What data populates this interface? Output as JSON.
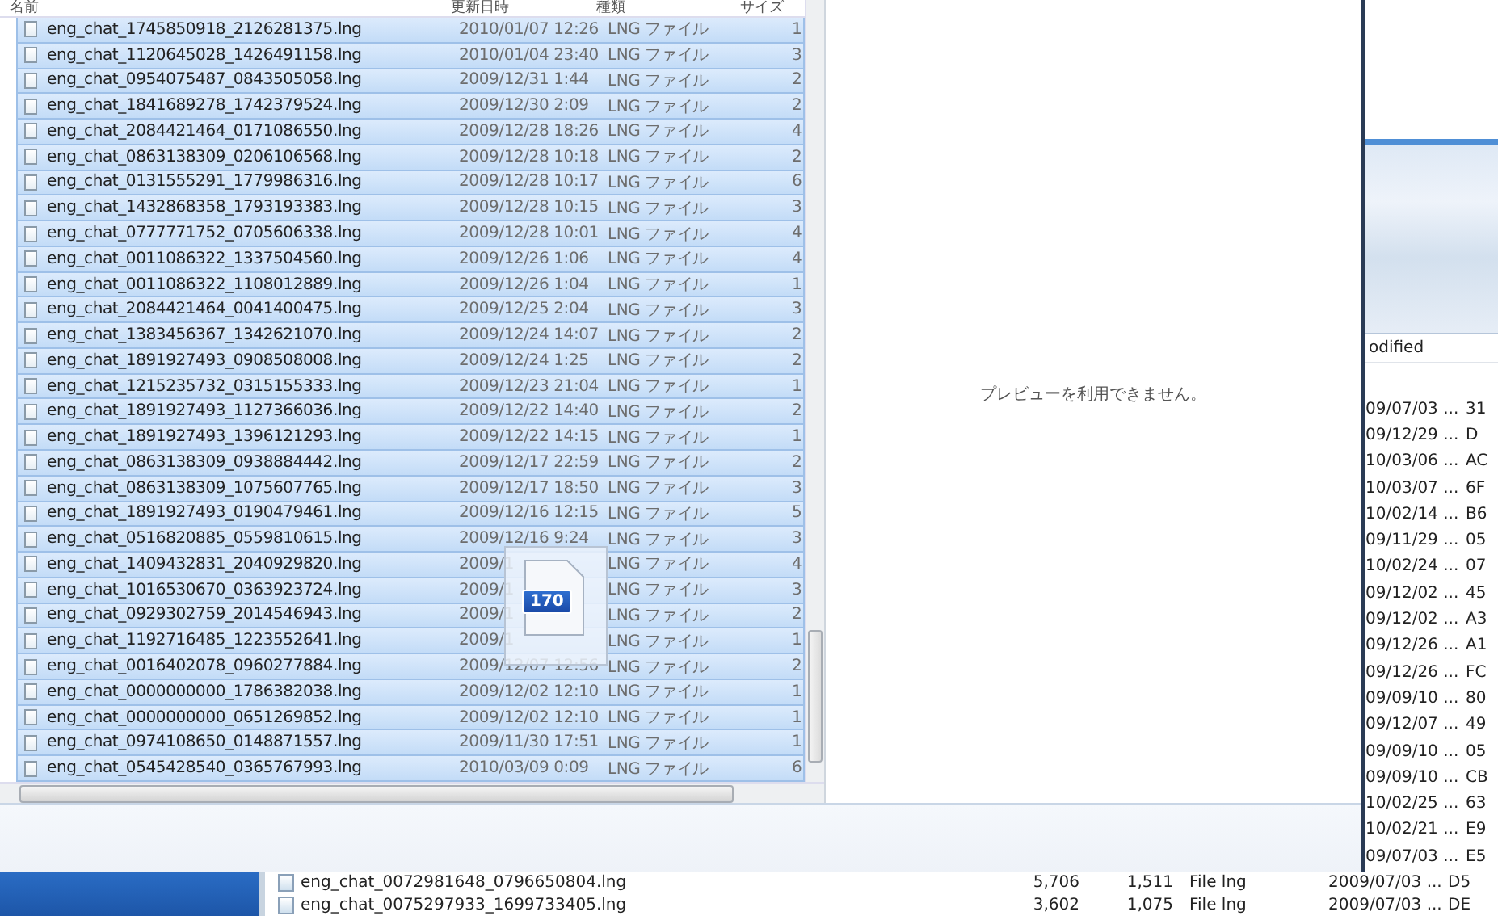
{
  "file_list": {
    "columns": [
      "名前",
      "更新日時",
      "種類",
      "サイズ"
    ],
    "rows": [
      {
        "name": "eng_chat_1745850918_2126281375.lng",
        "modified": "2010/01/07 12:26",
        "type": "LNG ファイル",
        "size": "1",
        "selected": true
      },
      {
        "name": "eng_chat_1120645028_1426491158.lng",
        "modified": "2010/01/04 23:40",
        "type": "LNG ファイル",
        "size": "3",
        "selected": true
      },
      {
        "name": "eng_chat_0954075487_0843505058.lng",
        "modified": "2009/12/31 1:44",
        "type": "LNG ファイル",
        "size": "2",
        "selected": true
      },
      {
        "name": "eng_chat_1841689278_1742379524.lng",
        "modified": "2009/12/30 2:09",
        "type": "LNG ファイル",
        "size": "2",
        "selected": true
      },
      {
        "name": "eng_chat_2084421464_0171086550.lng",
        "modified": "2009/12/28 18:26",
        "type": "LNG ファイル",
        "size": "4",
        "selected": true
      },
      {
        "name": "eng_chat_0863138309_0206106568.lng",
        "modified": "2009/12/28 10:18",
        "type": "LNG ファイル",
        "size": "2",
        "selected": true
      },
      {
        "name": "eng_chat_0131555291_1779986316.lng",
        "modified": "2009/12/28 10:17",
        "type": "LNG ファイル",
        "size": "6",
        "selected": true
      },
      {
        "name": "eng_chat_1432868358_1793193383.lng",
        "modified": "2009/12/28 10:15",
        "type": "LNG ファイル",
        "size": "3",
        "selected": true
      },
      {
        "name": "eng_chat_0777771752_0705606338.lng",
        "modified": "2009/12/28 10:01",
        "type": "LNG ファイル",
        "size": "4",
        "selected": true
      },
      {
        "name": "eng_chat_0011086322_1337504560.lng",
        "modified": "2009/12/26 1:06",
        "type": "LNG ファイル",
        "size": "4",
        "selected": true
      },
      {
        "name": "eng_chat_0011086322_1108012889.lng",
        "modified": "2009/12/26 1:04",
        "type": "LNG ファイル",
        "size": "1",
        "selected": true
      },
      {
        "name": "eng_chat_2084421464_0041400475.lng",
        "modified": "2009/12/25 2:04",
        "type": "LNG ファイル",
        "size": "3",
        "selected": true
      },
      {
        "name": "eng_chat_1383456367_1342621070.lng",
        "modified": "2009/12/24 14:07",
        "type": "LNG ファイル",
        "size": "2",
        "selected": true
      },
      {
        "name": "eng_chat_1891927493_0908508008.lng",
        "modified": "2009/12/24 1:25",
        "type": "LNG ファイル",
        "size": "2",
        "selected": true
      },
      {
        "name": "eng_chat_1215235732_0315155333.lng",
        "modified": "2009/12/23 21:04",
        "type": "LNG ファイル",
        "size": "1",
        "selected": true
      },
      {
        "name": "eng_chat_1891927493_1127366036.lng",
        "modified": "2009/12/22 14:40",
        "type": "LNG ファイル",
        "size": "2",
        "selected": true
      },
      {
        "name": "eng_chat_1891927493_1396121293.lng",
        "modified": "2009/12/22 14:15",
        "type": "LNG ファイル",
        "size": "1",
        "selected": true
      },
      {
        "name": "eng_chat_0863138309_0938884442.lng",
        "modified": "2009/12/17 22:59",
        "type": "LNG ファイル",
        "size": "2",
        "selected": true
      },
      {
        "name": "eng_chat_0863138309_1075607765.lng",
        "modified": "2009/12/17 18:50",
        "type": "LNG ファイル",
        "size": "3",
        "selected": true
      },
      {
        "name": "eng_chat_1891927493_0190479461.lng",
        "modified": "2009/12/16 12:15",
        "type": "LNG ファイル",
        "size": "5",
        "selected": true
      },
      {
        "name": "eng_chat_0516820885_0559810615.lng",
        "modified": "2009/12/16 9:24",
        "type": "LNG ファイル",
        "size": "3",
        "selected": true
      },
      {
        "name": "eng_chat_1409432831_2040929820.lng",
        "modified": "2009/1",
        "type": "LNG ファイル",
        "size": "4",
        "selected": true
      },
      {
        "name": "eng_chat_1016530670_0363923724.lng",
        "modified": "2009/1",
        "type": "LNG ファイル",
        "size": "3",
        "selected": true
      },
      {
        "name": "eng_chat_0929302759_2014546943.lng",
        "modified": "2009/1",
        "type": "LNG ファイル",
        "size": "2",
        "selected": true
      },
      {
        "name": "eng_chat_1192716485_1223552641.lng",
        "modified": "2009/1",
        "type": "LNG ファイル",
        "size": "1",
        "selected": true
      },
      {
        "name": "eng_chat_0016402078_0960277884.lng",
        "modified": "2009/12/07 12:56",
        "type": "LNG ファイル",
        "size": "2",
        "selected": true
      },
      {
        "name": "eng_chat_0000000000_1786382038.lng",
        "modified": "2009/12/02 12:10",
        "type": "LNG ファイル",
        "size": "1",
        "selected": true
      },
      {
        "name": "eng_chat_0000000000_0651269852.lng",
        "modified": "2009/12/02 12:10",
        "type": "LNG ファイル",
        "size": "1",
        "selected": true
      },
      {
        "name": "eng_chat_0974108650_0148871557.lng",
        "modified": "2009/11/30 17:51",
        "type": "LNG ファイル",
        "size": "1",
        "selected": true
      },
      {
        "name": "eng_chat_0545428540_0365767993.lng",
        "modified": "2010/03/09 0:09",
        "type": "LNG ファイル",
        "size": "6",
        "selected": true
      }
    ]
  },
  "drag_badge": {
    "count": "170"
  },
  "preview": {
    "message": "プレビューを利用できません。"
  },
  "background_window": {
    "column_header": "odified",
    "right_rows": [
      {
        "date": "09/07/03 ...",
        "hex": "31"
      },
      {
        "date": "09/12/29 ...",
        "hex": "D"
      },
      {
        "date": "10/03/06 ...",
        "hex": "AC"
      },
      {
        "date": "10/03/07 ...",
        "hex": "6F"
      },
      {
        "date": "10/02/14 ...",
        "hex": "B6"
      },
      {
        "date": "09/11/29 ...",
        "hex": "05"
      },
      {
        "date": "10/02/24 ...",
        "hex": "07"
      },
      {
        "date": "09/12/02 ...",
        "hex": "45"
      },
      {
        "date": "09/12/02 ...",
        "hex": "A3"
      },
      {
        "date": "09/12/26 ...",
        "hex": "A1"
      },
      {
        "date": "09/12/26 ...",
        "hex": "FC"
      },
      {
        "date": "09/09/10 ...",
        "hex": "80"
      },
      {
        "date": "09/12/07 ...",
        "hex": "49"
      },
      {
        "date": "09/09/10 ...",
        "hex": "05"
      },
      {
        "date": "09/09/10 ...",
        "hex": "CB"
      },
      {
        "date": "10/02/25 ...",
        "hex": "63"
      },
      {
        "date": "10/02/21 ...",
        "hex": "E9"
      },
      {
        "date": "09/07/03 ...",
        "hex": "E5"
      }
    ],
    "bottom_rows": [
      {
        "name": "eng_chat_0072981648_0796650804.lng",
        "size_1": "5,706",
        "size_2": "1,511",
        "type": "File lng",
        "date": "2009/07/03 ...",
        "hex": "D5"
      },
      {
        "name": "eng_chat_0075297933_1699733405.lng",
        "size_1": "3,602",
        "size_2": "1,075",
        "type": "File lng",
        "date": "2009/07/03 ...",
        "hex": "DE"
      }
    ]
  }
}
